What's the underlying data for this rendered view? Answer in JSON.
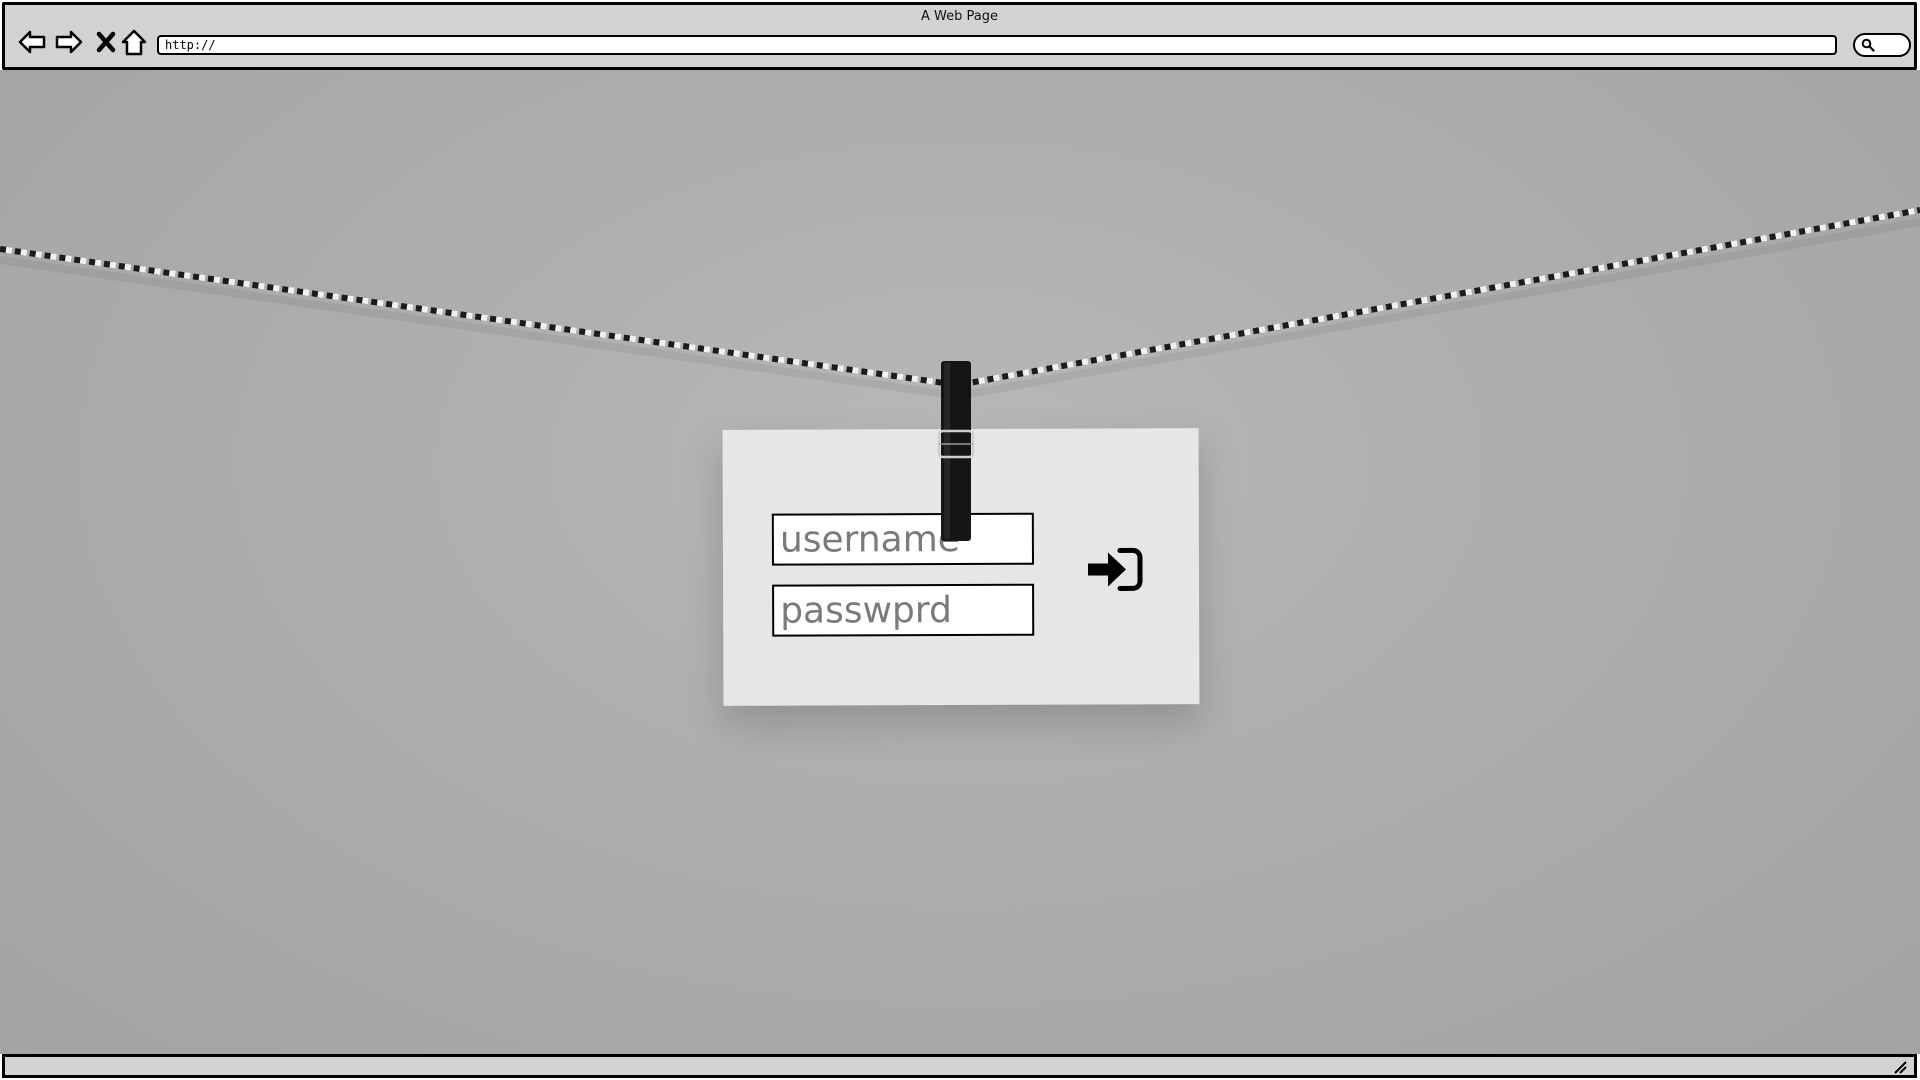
{
  "window": {
    "title": "A Web Page"
  },
  "toolbar": {
    "back_icon": "back-arrow-icon",
    "forward_icon": "forward-arrow-icon",
    "stop_icon": "close-icon",
    "home_icon": "home-icon",
    "url": "http://",
    "search_icon": "search-icon"
  },
  "login_card": {
    "username_placeholder": "username",
    "password_placeholder": "passwprd",
    "submit_icon": "sign-in-icon"
  },
  "colors": {
    "chrome_bg": "#d2d2d2",
    "page_bg": "#adadad",
    "card_bg": "#e6e6e6",
    "border": "#000000",
    "placeholder_text": "#7a7a7a"
  }
}
